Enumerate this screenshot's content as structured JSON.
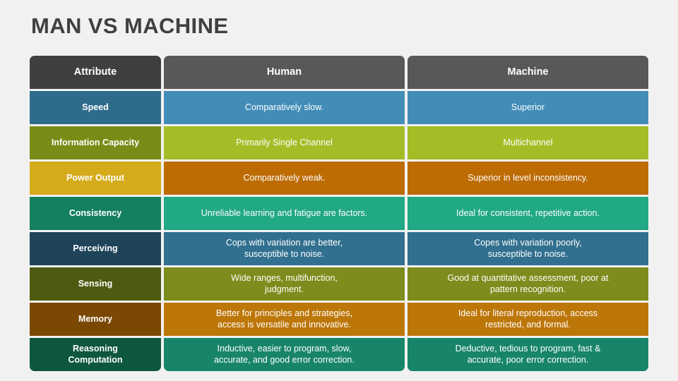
{
  "title": "MAN VS MACHINE",
  "background_color": "#f1f1f1",
  "title_color": "#404040",
  "table": {
    "columns": [
      "Attribute",
      "Human",
      "Machine"
    ],
    "header": {
      "attribute_label": "Attribute",
      "human_label": "Human",
      "machine_label": "Machine",
      "attribute_color": "#3f3f3f",
      "human_color": "#585858",
      "machine_color": "#585858"
    },
    "rows": [
      {
        "attribute": "Speed",
        "human": "Comparatively slow.",
        "human_line2": "",
        "machine": "Superior",
        "machine_line2": "",
        "attribute_color": "#2f6c8c",
        "value_color": "#428db8"
      },
      {
        "attribute": "Information Capacity",
        "human": "Primarily Single Channel",
        "human_line2": "",
        "machine": "Multichannel",
        "machine_line2": "",
        "attribute_color": "#7a8c17",
        "value_color": "#a6bc27"
      },
      {
        "attribute": "Power Output",
        "human": "Comparatively weak.",
        "human_line2": "",
        "machine": "Superior in level inconsistency.",
        "machine_line2": "",
        "attribute_color": "#d4ab1b",
        "value_color": "#bd6b03"
      },
      {
        "attribute": "Consistency",
        "human": "Unreliable learning and fatigue are factors.",
        "human_line2": "",
        "machine": "Ideal for consistent, repetitive action.",
        "machine_line2": "",
        "attribute_color": "#13805f",
        "value_color": "#21a884"
      },
      {
        "attribute": "Perceiving",
        "human": "Cops with variation are better,",
        "human_line2": "susceptible to noise.",
        "machine": "Copes with variation poorly,",
        "machine_line2": "susceptible to noise.",
        "attribute_color": "#1f4459",
        "value_color": "#31708f"
      },
      {
        "attribute": "Sensing",
        "human": "Wide ranges, multifunction,",
        "human_line2": "judgment.",
        "machine": "Good at quantitative assessment, poor at",
        "machine_line2": "pattern recognition.",
        "attribute_color": "#4e5a10",
        "value_color": "#7d8c1c"
      },
      {
        "attribute": "Memory",
        "human": "Better for principles and strategies,",
        "human_line2": "access is versatile and innovative.",
        "machine": "Ideal for literal reproduction, access",
        "machine_line2": "restricted, and formal.",
        "attribute_color": "#7a4803",
        "value_color": "#bd7709"
      },
      {
        "attribute": "Reasoning",
        "attribute_line2": "Computation",
        "human": "Inductive, easier to program, slow,",
        "human_line2": "accurate, and good error correction.",
        "machine": "Deductive, tedious to program, fast &",
        "machine_line2": "accurate, poor error correction.",
        "attribute_color": "#0d5640",
        "value_color": "#18856a"
      }
    ]
  }
}
